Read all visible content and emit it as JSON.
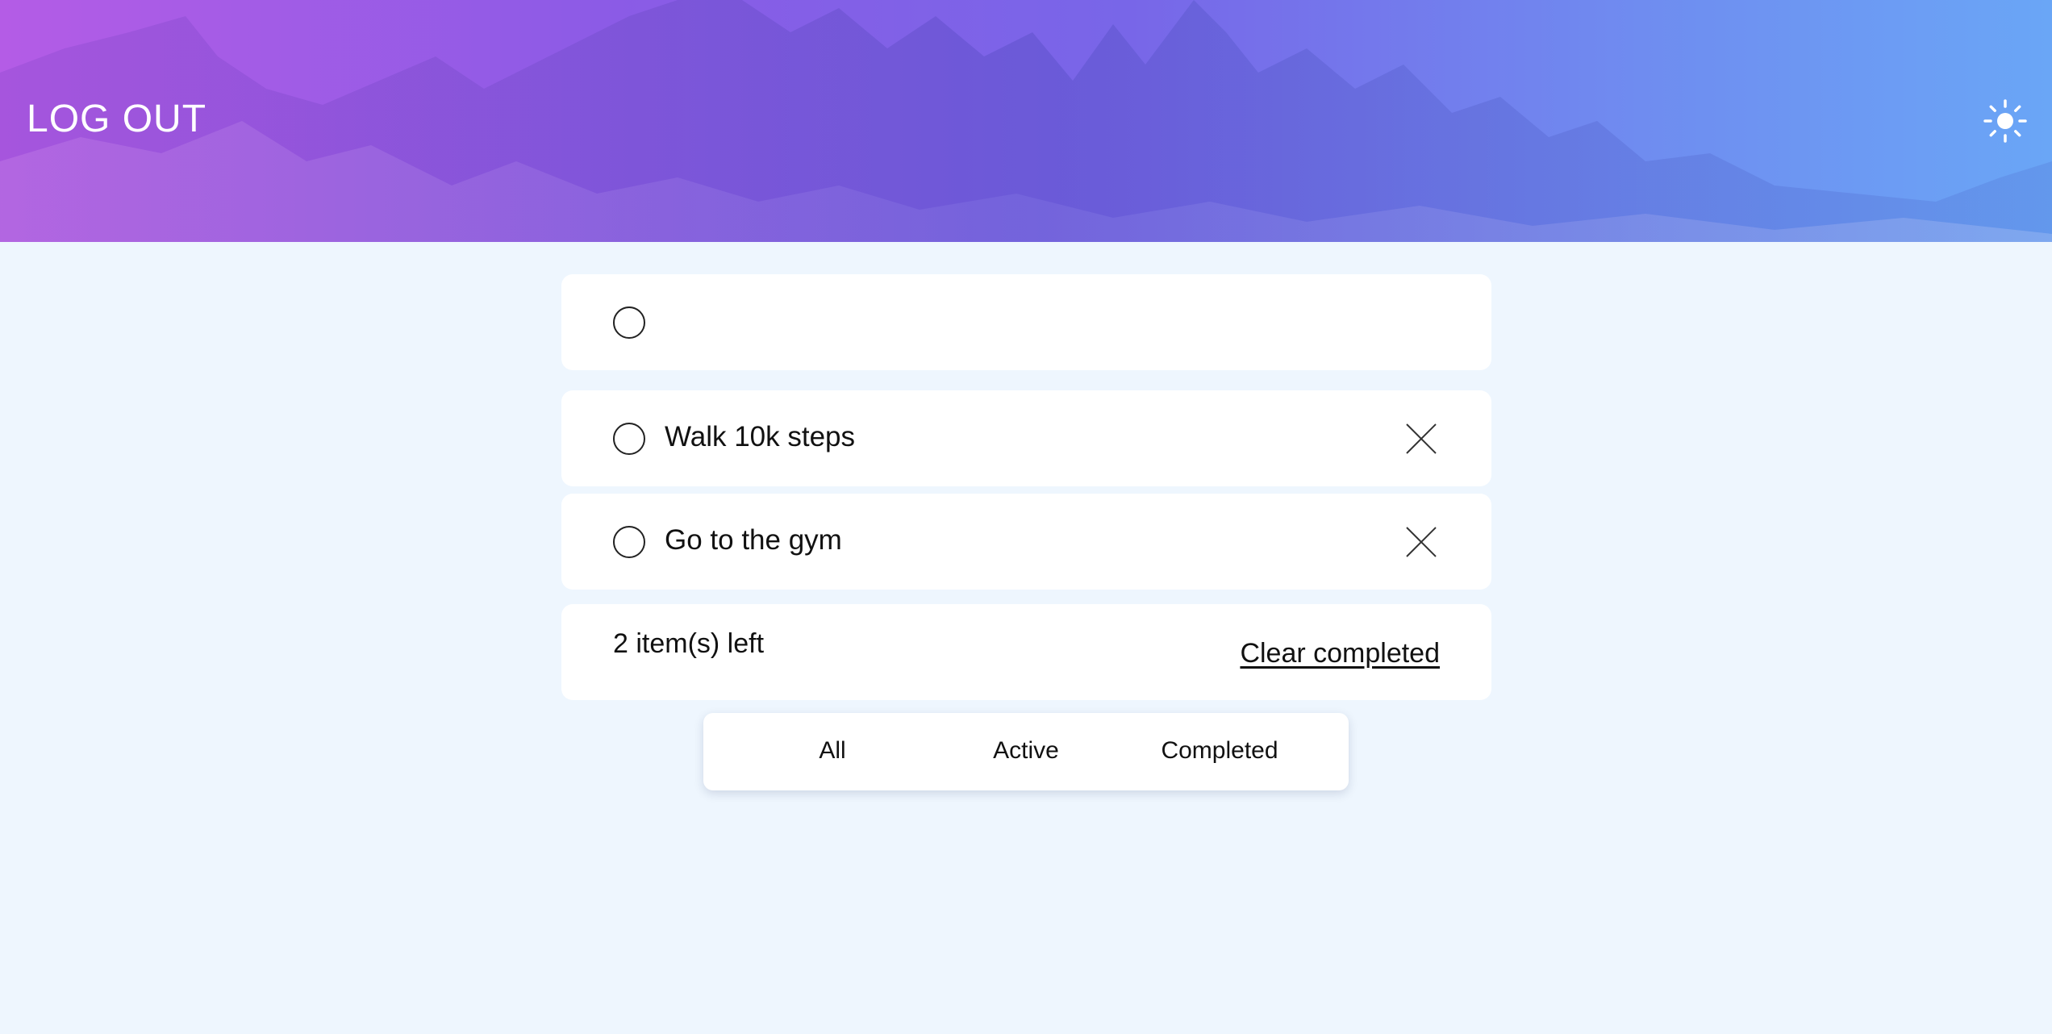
{
  "header": {
    "logout_label": "LOG OUT",
    "theme_icon": "sun-icon",
    "gradient_colors": [
      "#b45ce6",
      "#8b5be6",
      "#7866e8",
      "#6f8cf0",
      "#6aa6f6"
    ]
  },
  "new_todo": {
    "value": "",
    "placeholder": ""
  },
  "todos": [
    {
      "text": "Walk 10k steps",
      "completed": false
    },
    {
      "text": "Go to the gym",
      "completed": false
    }
  ],
  "footer": {
    "items_left": "2 item(s) left",
    "clear_completed_label": "Clear completed"
  },
  "filters": [
    {
      "label": "All"
    },
    {
      "label": "Active"
    },
    {
      "label": "Completed"
    }
  ],
  "colors": {
    "page_background": "#eef6fe",
    "card_background": "#ffffff",
    "text": "#111111"
  }
}
